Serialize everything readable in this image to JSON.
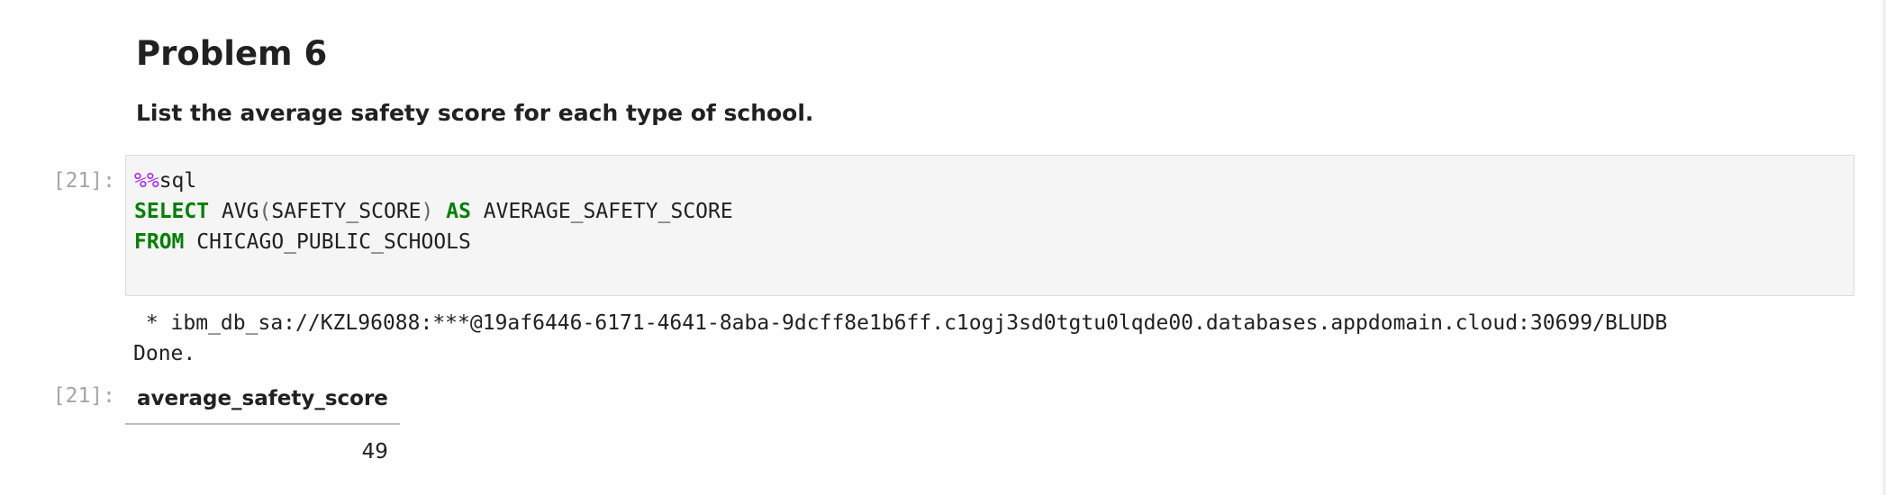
{
  "markdown": {
    "heading": "Problem 6",
    "paragraph": "List the average safety score for each type of school."
  },
  "input_cell": {
    "prompt": "[21]:",
    "code": {
      "line1_magic": "%%",
      "line1_rest": "sql",
      "line2_kw_select": "SELECT",
      "line2_func": " AVG",
      "line2_paren_open": "(",
      "line2_arg": "SAFETY_SCORE",
      "line2_paren_close": ")",
      "line2_kw_as": " AS",
      "line2_alias": " AVERAGE_SAFETY_SCORE",
      "line3_kw_from": "FROM",
      "line3_table": " CHICAGO_PUBLIC_SCHOOLS"
    }
  },
  "stream_output": {
    "connection": " * ibm_db_sa://KZL96088:***@19af6446-6171-4641-8aba-9dcff8e1b6ff.c1ogj3sd0tgtu0lqde00.databases.appdomain.cloud:30699/BLUDB",
    "status": "Done."
  },
  "result_cell": {
    "prompt": "[21]:",
    "columns": [
      "average_safety_score"
    ],
    "rows": [
      [
        "49"
      ]
    ]
  }
}
